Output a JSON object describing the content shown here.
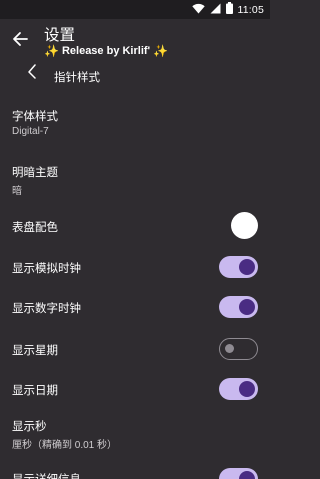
{
  "status_bar": {
    "time": "11:05"
  },
  "app_bar": {
    "title": "设置",
    "subtitle": "Release by Kirlif'"
  },
  "settings": {
    "pointer_style": {
      "label": "指针样式"
    },
    "font_style": {
      "label": "字体样式",
      "value": "Digital-7"
    },
    "theme": {
      "label": "明暗主题",
      "value": "暗"
    },
    "dial_color": {
      "label": "表盘配色",
      "color": "#ffffff"
    },
    "show_analog": {
      "label": "显示模拟时钟",
      "checked": true
    },
    "show_digital": {
      "label": "显示数字时钟",
      "checked": true
    },
    "show_weekday": {
      "label": "显示星期",
      "checked": false
    },
    "show_date": {
      "label": "显示日期",
      "checked": true
    },
    "show_seconds": {
      "label": "显示秒",
      "value": "厘秒（精确到 0.01 秒）"
    },
    "show_detail": {
      "label": "显示详细信息",
      "checked": true
    }
  },
  "icons": {
    "back": "arrow-left-icon",
    "wifi": "wifi-icon",
    "signal": "signal-icon",
    "battery": "battery-icon",
    "pointer": "clock-hand-icon",
    "sparkle": "sparkle-icon"
  }
}
